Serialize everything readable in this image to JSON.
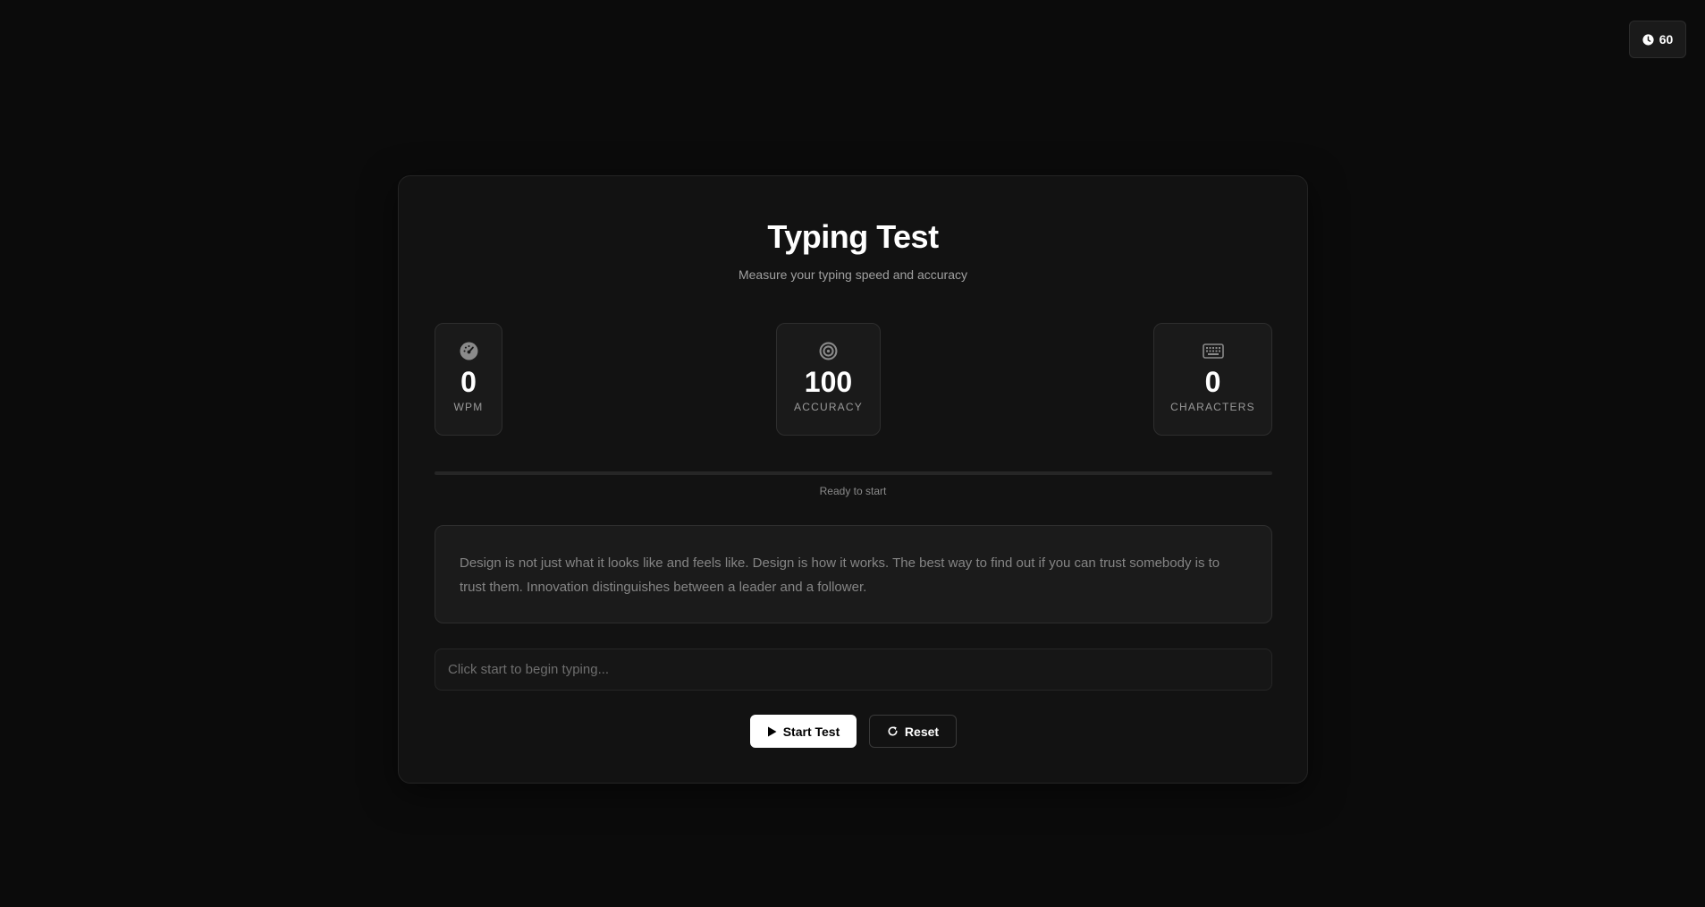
{
  "timer": {
    "value": "60",
    "icon": "clock-icon"
  },
  "header": {
    "title": "Typing Test",
    "subtitle": "Measure your typing speed and accuracy"
  },
  "stats": {
    "wpm": {
      "value": "0",
      "label": "WPM",
      "icon": "speedometer-icon"
    },
    "accuracy": {
      "value": "100",
      "label": "ACCURACY",
      "icon": "target-icon"
    },
    "characters": {
      "value": "0",
      "label": "CHARACTERS",
      "icon": "keyboard-icon"
    }
  },
  "progress": {
    "fraction": 0
  },
  "status": "Ready to start",
  "passage": "Design is not just what it looks like and feels like. Design is how it works. The best way to find out if you can trust somebody is to trust them. Innovation distinguishes between a leader and a follower.",
  "input": {
    "value": "",
    "placeholder": "Click start to begin typing..."
  },
  "buttons": {
    "start_label": "Start Test",
    "start_icon": "play-icon",
    "reset_label": "Reset",
    "reset_icon": "refresh-icon"
  },
  "colors": {
    "background": "#0b0b0b",
    "card": "#121212",
    "accent": "#ffffff",
    "muted_text": "#a0a0a0"
  }
}
